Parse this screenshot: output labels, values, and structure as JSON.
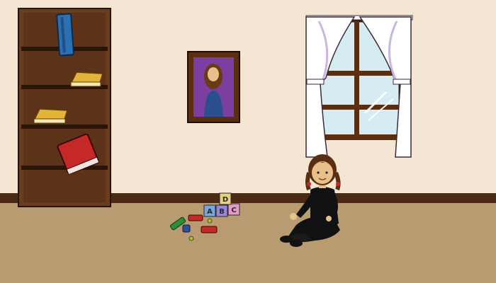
{
  "scene": {
    "type": "cartoon-illustration",
    "setting": "child's bedroom",
    "colors": {
      "wall": "#f5e6d3",
      "floor": "#b89b70",
      "baseboard": "#4a2a12",
      "shelf_wood": "#6b3d1f",
      "frame": "#5a2e10",
      "curtain": "#ffffff",
      "curtain_shadow": "#c9b6e0",
      "sky": "#d6ecf3",
      "shirt": "#111111",
      "skin": "#e8c08a",
      "hair": "#5a2e10"
    },
    "books": [
      {
        "name": "blue-book",
        "color": "#2d6fb4"
      },
      {
        "name": "yellow-book",
        "color": "#e2b53a"
      },
      {
        "name": "yellow-book",
        "color": "#e2b53a"
      },
      {
        "name": "red-book",
        "color": "#c62828"
      }
    ],
    "blocks": [
      {
        "letter": "A",
        "color": "#7aa6e0"
      },
      {
        "letter": "B",
        "color": "#9a86d6"
      },
      {
        "letter": "C",
        "color": "#e49ac6"
      },
      {
        "letter": "D",
        "color": "#e6d27a"
      }
    ]
  }
}
